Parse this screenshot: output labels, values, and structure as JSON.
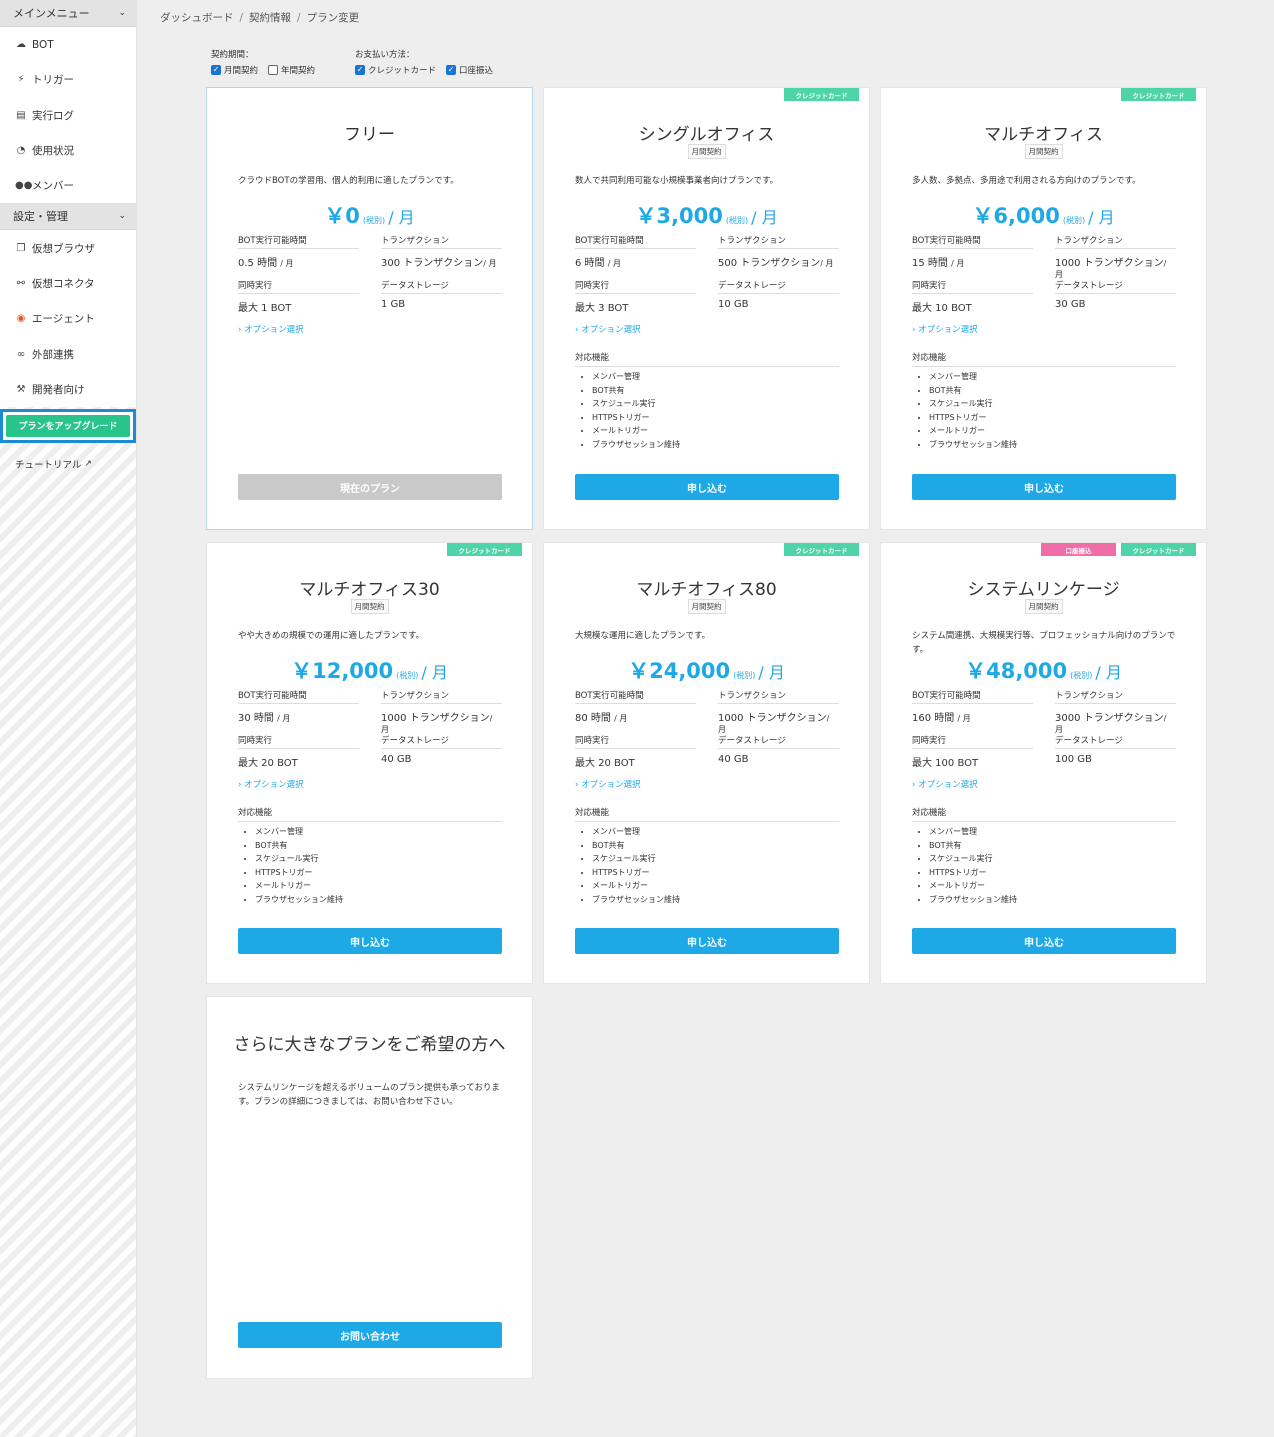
{
  "sidebar": {
    "main_menu_header": "メインメニュー",
    "main_items": [
      {
        "label": "BOT",
        "icon": "cloud-icon"
      },
      {
        "label": "トリガー",
        "icon": "bolt-icon"
      },
      {
        "label": "実行ログ",
        "icon": "file-icon"
      },
      {
        "label": "使用状況",
        "icon": "pie-chart-icon"
      },
      {
        "label": "メンバー",
        "icon": "users-icon"
      }
    ],
    "settings_header": "設定・管理",
    "settings_items": [
      {
        "label": "仮想ブラウザ",
        "icon": "window-icon"
      },
      {
        "label": "仮想コネクタ",
        "icon": "connector-icon"
      },
      {
        "label": "エージェント",
        "icon": "agent-icon"
      },
      {
        "label": "外部連携",
        "icon": "link-icon"
      },
      {
        "label": "開発者向け",
        "icon": "wrench-icon"
      }
    ],
    "upgrade_label": "プランをアップグレード",
    "tutorial_label": "チュートリアル"
  },
  "breadcrumb": [
    "ダッシュボード",
    "契約情報",
    "プラン変更"
  ],
  "filters": {
    "period_title": "契約期間：",
    "period_options": [
      {
        "label": "月間契約",
        "checked": true
      },
      {
        "label": "年間契約",
        "checked": false
      }
    ],
    "payment_title": "お支払い方法：",
    "payment_options": [
      {
        "label": "クレジットカード",
        "checked": true
      },
      {
        "label": "口座振込",
        "checked": true
      }
    ]
  },
  "labels": {
    "bot_hours": "BOT実行可能時間",
    "transactions": "トランザクション",
    "concurrent": "同時実行",
    "storage": "データストレージ",
    "option": "オプション選択",
    "features_title": "対応機能",
    "tax": "(税別)",
    "per_month": "/ 月",
    "hours_unit": "/ 月",
    "tx_unit": "/ 月"
  },
  "features": [
    "メンバー管理",
    "BOT共有",
    "スケジュール実行",
    "HTTPSトリガー",
    "メールトリガー",
    "ブラウザセッション維持"
  ],
  "plans": [
    {
      "title": "フリー",
      "contract": "",
      "badges": [],
      "desc": "クラウドBOTの学習用、個人的利用に適したプランです。",
      "price": "￥0",
      "hours": "0.5 時間",
      "tx": "300 トランザクション",
      "concurrent": "最大 1 BOT",
      "storage": "1 GB",
      "button": "現在のプラン",
      "current": true
    },
    {
      "title": "シングルオフィス",
      "contract": "月間契約",
      "badges": [
        "クレジットカード"
      ],
      "desc": "数人で共同利用可能な小規模事業者向けプランです。",
      "price": "￥3,000",
      "hours": "6 時間",
      "tx": "500 トランザクション",
      "concurrent": "最大 3 BOT",
      "storage": "10 GB",
      "button": "申し込む",
      "current": false
    },
    {
      "title": "マルチオフィス",
      "contract": "月間契約",
      "badges": [
        "クレジットカード"
      ],
      "desc": "多人数、多拠点、多用途で利用される方向けのプランです。",
      "price": "￥6,000",
      "hours": "15 時間",
      "tx": "1000 トランザクション",
      "concurrent": "最大 10 BOT",
      "storage": "30 GB",
      "button": "申し込む",
      "current": false
    },
    {
      "title": "マルチオフィス30",
      "contract": "月間契約",
      "badges": [
        "クレジットカード"
      ],
      "desc": "やや大きめの規模での運用に適したプランです。",
      "price": "￥12,000",
      "hours": "30 時間",
      "tx": "1000 トランザクション",
      "concurrent": "最大 20 BOT",
      "storage": "40 GB",
      "button": "申し込む",
      "current": false
    },
    {
      "title": "マルチオフィス80",
      "contract": "月間契約",
      "badges": [
        "クレジットカード"
      ],
      "desc": "大規模な運用に適したプランです。",
      "price": "￥24,000",
      "hours": "80 時間",
      "tx": "1000 トランザクション",
      "concurrent": "最大 20 BOT",
      "storage": "40 GB",
      "button": "申し込む",
      "current": false
    },
    {
      "title": "システムリンケージ",
      "contract": "月間契約",
      "badges": [
        "口座振込",
        "クレジットカード"
      ],
      "desc": "システム間連携、大規模実行等、プロフェッショナル向けのプランです。",
      "price": "￥48,000",
      "hours": "160 時間",
      "tx": "3000 トランザクション",
      "concurrent": "最大 100 BOT",
      "storage": "100 GB",
      "button": "申し込む",
      "current": false
    }
  ],
  "custom_plan": {
    "title": "さらに大きなプランをご希望の方へ",
    "desc": "システムリンケージを超えるボリュームのプラン提供も承っております。プランの詳細につきましては、お問い合わせ下さい。",
    "button": "お問い合わせ"
  },
  "colors": {
    "accent": "#1fa8e6",
    "upgrade": "#29c38c",
    "badge_credit": "#4ed4a8",
    "badge_bank": "#ef6ea8"
  }
}
